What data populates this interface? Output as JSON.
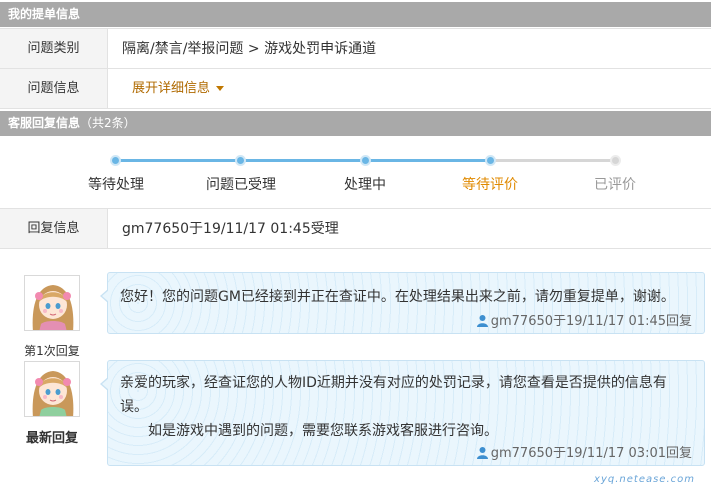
{
  "ticket_section": {
    "title": "我的提单信息"
  },
  "ticket_rows": [
    {
      "label": "问题类别",
      "value": "隔离/禁言/举报问题 > 游戏处罚申诉通道"
    },
    {
      "label": "问题信息",
      "value": "展开详细信息"
    }
  ],
  "service_section": {
    "title": "客服回复信息",
    "count": "（共2条）"
  },
  "progress": {
    "steps": [
      {
        "label": "等待处理",
        "state": "done"
      },
      {
        "label": "问题已受理",
        "state": "done"
      },
      {
        "label": "处理中",
        "state": "done"
      },
      {
        "label": "等待评价",
        "state": "current"
      },
      {
        "label": "已评价",
        "state": "pending"
      }
    ]
  },
  "reply_info": {
    "label": "回复信息",
    "value": "gm77650于19/11/17 01:45受理"
  },
  "replies": [
    {
      "caption": "第1次回复",
      "lines": [
        "您好！您的问题GM已经接到并正在查证中。在处理结果出来之前，请勿重复提单，谢谢。"
      ],
      "meta": "gm77650于19/11/17 01:45回复"
    },
    {
      "caption": "最新回复",
      "lines": [
        "亲爱的玩家，经查证您的人物ID近期并没有对应的处罚记录，请您查看是否提供的信息有误。",
        "　　如是游戏中遇到的问题，需要您联系游戏客服进行咨询。"
      ],
      "meta": "gm77650于19/11/17 03:01回复"
    }
  ],
  "watermark": "xyq.netease.com",
  "colors": {
    "header_bg": "#a9a9a9",
    "accent": "#e08a00",
    "progress": "#6ab6e5",
    "bubble_bg": "#eaf6fd"
  }
}
